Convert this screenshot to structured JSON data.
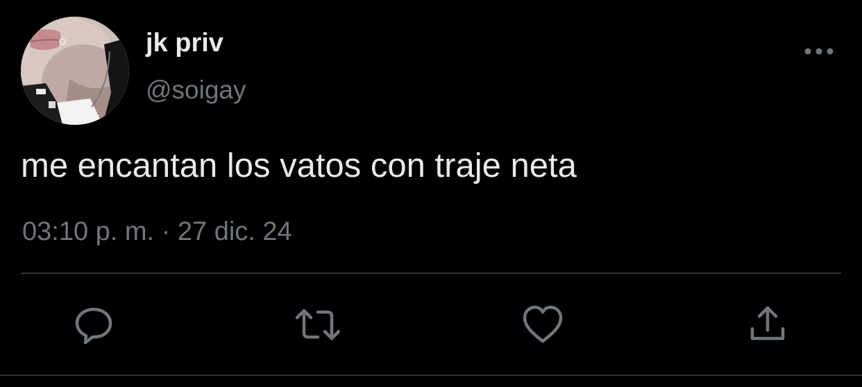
{
  "tweet": {
    "author": {
      "display_name": "jk priv",
      "handle": "@soigay",
      "avatar_icon": "profile-photo"
    },
    "text": "me encantan los vatos con traje neta",
    "timestamp": "03:10 p. m. · 27 dic. 24",
    "menu_icon": "more-horizontal-icon"
  },
  "actions": [
    {
      "name": "reply",
      "icon": "comment-bubble-icon"
    },
    {
      "name": "retweet",
      "icon": "retweet-arrows-icon"
    },
    {
      "name": "like",
      "icon": "heart-outline-icon"
    },
    {
      "name": "share",
      "icon": "share-upload-icon"
    }
  ],
  "colors": {
    "background": "#000000",
    "primary_text": "#e7e9ea",
    "secondary_text": "#71767b",
    "divider": "#2f3336"
  }
}
